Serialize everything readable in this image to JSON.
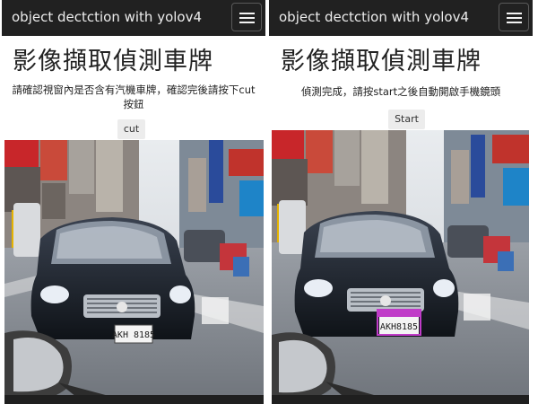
{
  "left_screen": {
    "brand": "object dectction with yolov4",
    "title": "影像擷取偵測車牌",
    "instruction": "請確認視窗內是否含有汽機車牌，確認完後請按下cut按鈕",
    "button_label": "cut",
    "plate_text": "AKH 8185"
  },
  "right_screen": {
    "brand": "object dectction with yolov4",
    "title": "影像擷取偵測車牌",
    "instruction": "偵測完成，請按start之後自動開啟手機鏡頭",
    "button_label": "Start",
    "plate_text": "AKH8185"
  },
  "colors": {
    "navbar": "#212121",
    "detection_box": "#c03cc8"
  },
  "icons": [
    "menu-icon"
  ]
}
